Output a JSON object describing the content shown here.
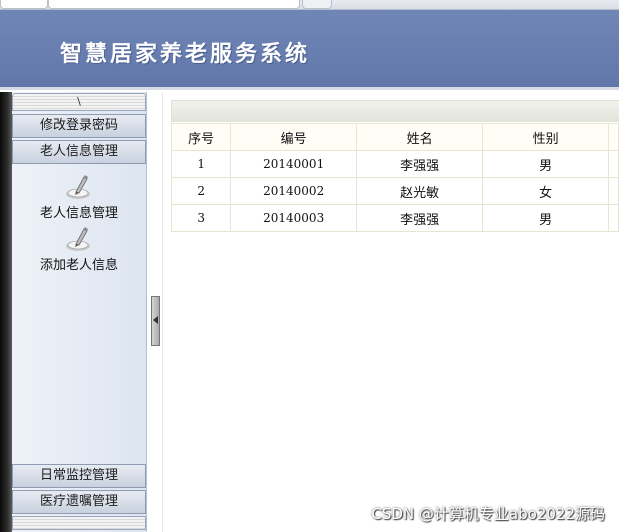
{
  "app": {
    "title": "智慧居家养老服务系统"
  },
  "sidebar": {
    "collapse_label": "\\",
    "menus": [
      {
        "label": "修改登录密码"
      },
      {
        "label": "老人信息管理"
      },
      {
        "label": "日常监控管理"
      },
      {
        "label": "医疗遗嘱管理"
      }
    ],
    "sub_items": [
      {
        "label": "老人信息管理",
        "icon": "pencil-icon"
      },
      {
        "label": "添加老人信息",
        "icon": "pencil-icon"
      }
    ]
  },
  "table": {
    "columns": [
      "序号",
      "编号",
      "姓名",
      "性别"
    ],
    "rows": [
      [
        "1",
        "20140001",
        "李强强",
        "男"
      ],
      [
        "2",
        "20140002",
        "赵光敏",
        "女"
      ],
      [
        "3",
        "20140003",
        "李强强",
        "男"
      ]
    ]
  },
  "watermark": "CSDN @计算机专业abo2022源码",
  "colors": {
    "banner": "#6f86b6",
    "table_border": "#e5e7cf",
    "header_bg": "#fffdf5"
  }
}
